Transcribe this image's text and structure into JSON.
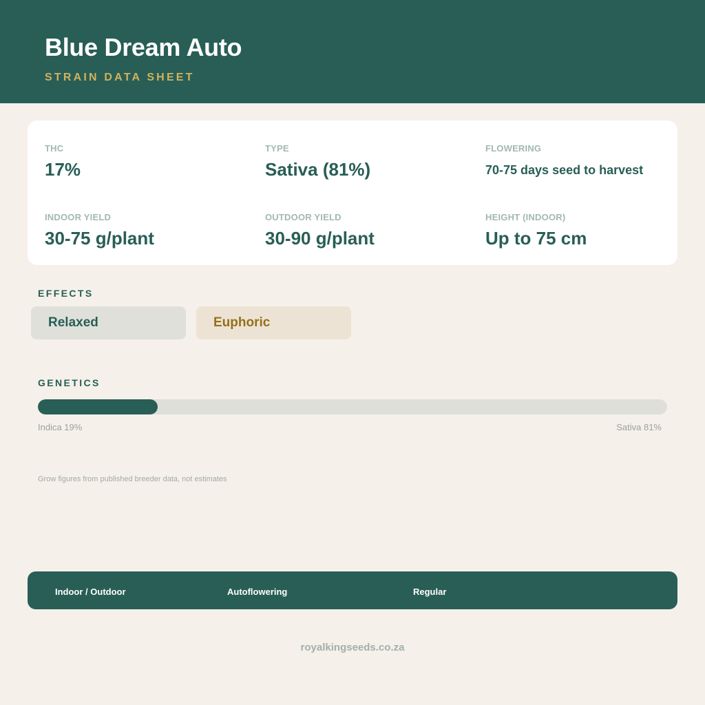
{
  "header": {
    "title": "Blue Dream Auto",
    "subtitle": "STRAIN DATA SHEET"
  },
  "stats": [
    {
      "label": "THC",
      "value": "17%"
    },
    {
      "label": "TYPE",
      "value": "Sativa (81%)"
    },
    {
      "label": "FLOWERING",
      "value": "70-75 days seed to harvest"
    },
    {
      "label": "INDOOR YIELD",
      "value": "30-75 g/plant"
    },
    {
      "label": "OUTDOOR YIELD",
      "value": "30-90 g/plant"
    },
    {
      "label": "HEIGHT (INDOOR)",
      "value": "Up to 75 cm"
    }
  ],
  "effects": {
    "heading": "EFFECTS",
    "items": [
      "Relaxed",
      "Euphoric"
    ]
  },
  "genetics": {
    "heading": "GENETICS",
    "indica_percent": 19,
    "sativa_percent": 81,
    "indica_label": "Indica 19%",
    "sativa_label": "Sativa 81%"
  },
  "note": "Grow figures from published breeder data, not estimates",
  "footer": {
    "items": [
      "Indoor / Outdoor",
      "Autoflowering",
      "Regular"
    ]
  },
  "website": "royalkingseeds.co.za",
  "colors": {
    "primary": "#285e56",
    "accent": "#d2b25e",
    "background": "#f5f0ea",
    "gold_text": "#94701c"
  }
}
